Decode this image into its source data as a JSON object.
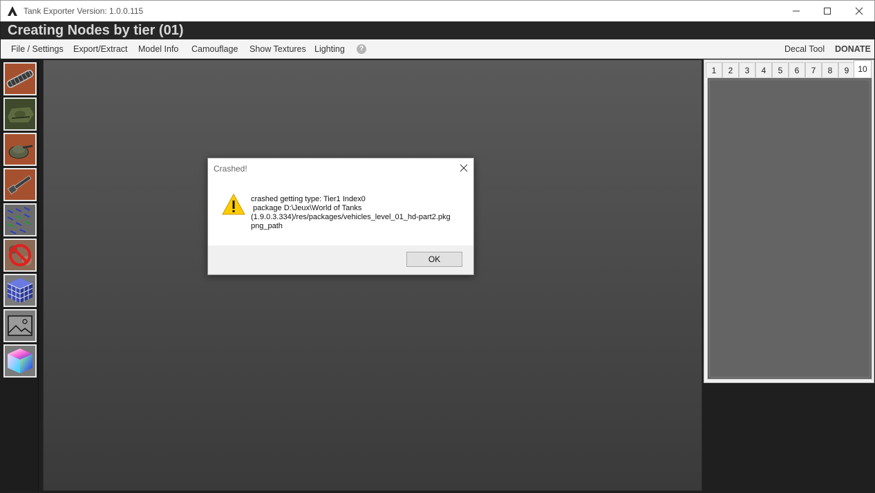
{
  "window": {
    "title": "Tank Exporter Version: 1.0.0.115",
    "controls": {
      "minimize_icon": "minimize-icon",
      "maximize_icon": "maximize-icon",
      "close_icon": "close-icon"
    }
  },
  "header": {
    "title": "Creating Nodes by tier (01)"
  },
  "menu": {
    "items": [
      {
        "label": "File / Settings"
      },
      {
        "label": "Export/Extract"
      },
      {
        "label": "Model Info"
      },
      {
        "label": "Camouflage"
      },
      {
        "label": "Show Textures"
      },
      {
        "label": "Lighting"
      }
    ],
    "help_icon": "?",
    "decal_tool": "Decal Tool",
    "donate": "DONATE"
  },
  "toolbar": {
    "tools": [
      {
        "icon": "tracks-icon"
      },
      {
        "icon": "hull-icon"
      },
      {
        "icon": "turret-icon"
      },
      {
        "icon": "gun-icon"
      },
      {
        "icon": "wireframe-icon"
      },
      {
        "icon": "no-camo-icon"
      },
      {
        "icon": "cube-grid-icon"
      },
      {
        "icon": "image-icon"
      },
      {
        "icon": "color-cube-icon"
      }
    ]
  },
  "tiers": {
    "tabs": [
      "1",
      "2",
      "3",
      "4",
      "5",
      "6",
      "7",
      "8",
      "9",
      "10"
    ],
    "active": "10"
  },
  "dialog": {
    "title": "Crashed!",
    "lines": [
      "crashed getting type: Tier1 Index0",
      " package D:\\Jeux\\World of Tanks",
      "(1.9.0.3.334)/res/packages/vehicles_level_01_hd-part2.pkg",
      "png_path"
    ],
    "ok_label": "OK"
  },
  "colors": {
    "header_bg": "#262626",
    "viewport_top": "#5a5a5a",
    "viewport_bottom": "#3a3a3a",
    "tool_bg": "#a5512f",
    "warning_yellow": "#ffcc00"
  }
}
